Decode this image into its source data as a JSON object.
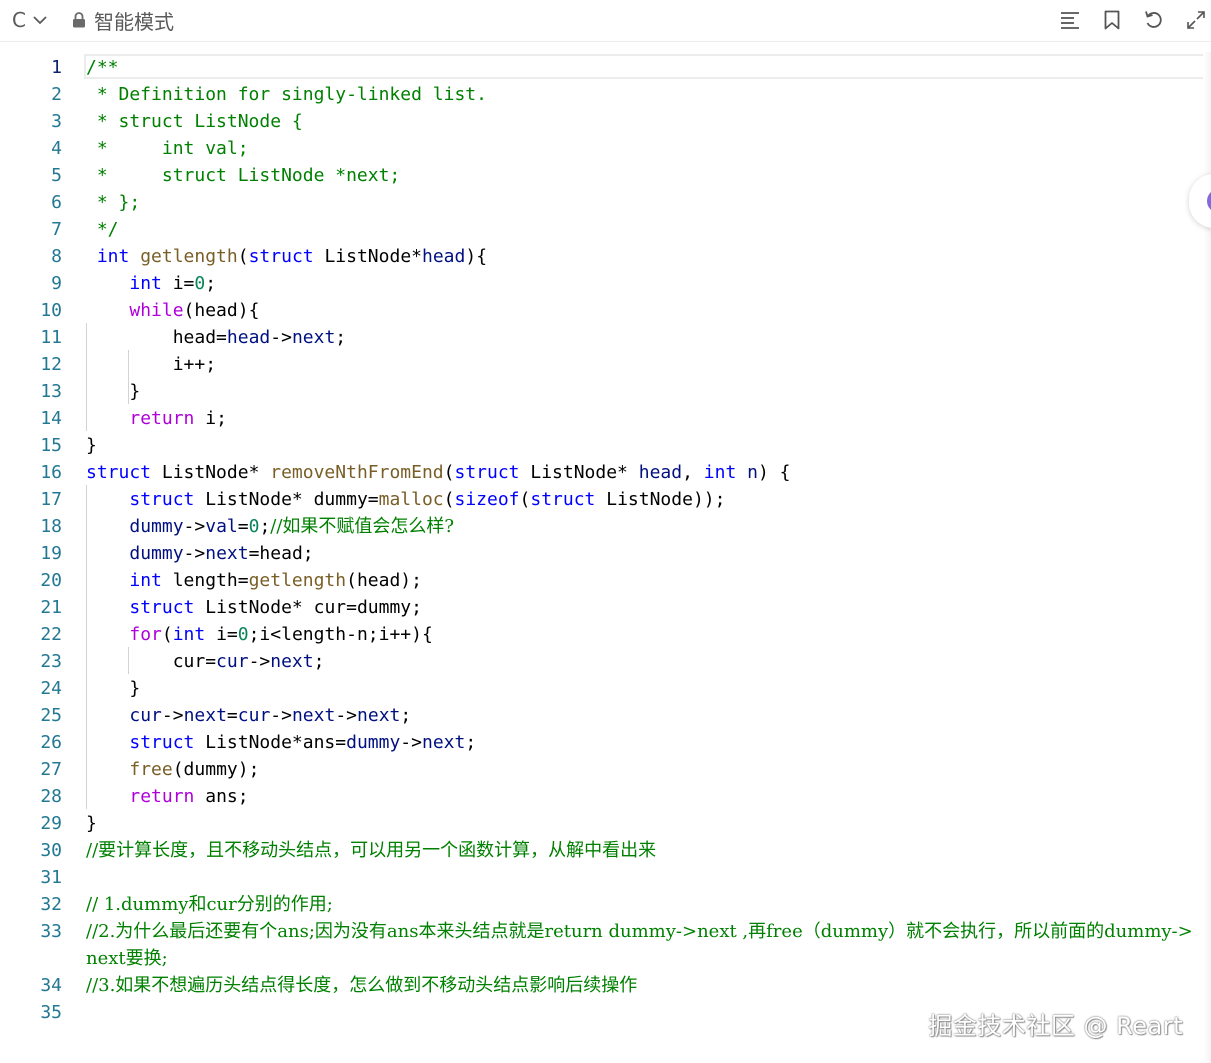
{
  "toolbar": {
    "language_label": "C",
    "mode_label": "智能模式",
    "icons": [
      "chevron-down-icon",
      "lock-icon",
      "format-icon",
      "bookmark-icon",
      "reset-icon",
      "expand-icon"
    ]
  },
  "colors": {
    "keyword": "#0000ff",
    "control": "#af00db",
    "function": "#795e26",
    "variable": "#001080",
    "number": "#098658",
    "comment": "#008000",
    "line_number": "#237893"
  },
  "editor": {
    "line_numbers": [
      "1",
      "2",
      "3",
      "4",
      "5",
      "6",
      "7",
      "8",
      "9",
      "10",
      "11",
      "12",
      "13",
      "14",
      "15",
      "16",
      "17",
      "18",
      "19",
      "20",
      "21",
      "22",
      "23",
      "24",
      "25",
      "26",
      "27",
      "28",
      "29",
      "30",
      "31",
      "32",
      "33",
      "34",
      "35"
    ],
    "lines": [
      [
        "/**"
      ],
      [
        " * Definition for singly-linked list."
      ],
      [
        " * struct ListNode {"
      ],
      [
        " *     int val;"
      ],
      [
        " *     struct ListNode *next;"
      ],
      [
        " * };"
      ],
      [
        " */"
      ],
      [
        " ",
        "int",
        " ",
        "getlength",
        "(",
        "struct",
        " ListNode*",
        "head",
        "){"
      ],
      [
        "    ",
        "int",
        " i=",
        "0",
        ";"
      ],
      [
        "    ",
        "while",
        "(head){"
      ],
      [
        "        head=",
        "head",
        "->",
        "next",
        ";"
      ],
      [
        "        i++;"
      ],
      [
        "    }"
      ],
      [
        "    ",
        "return",
        " i;"
      ],
      [
        "}"
      ],
      [
        "struct",
        " ListNode* ",
        "removeNthFromEnd",
        "(",
        "struct",
        " ListNode* ",
        "head",
        ", ",
        "int",
        " ",
        "n",
        ") {"
      ],
      [
        "    ",
        "struct",
        " ListNode* dummy=",
        "malloc",
        "(",
        "sizeof",
        "(",
        "struct",
        " ListNode));"
      ],
      [
        "    ",
        "dummy",
        "->",
        "val",
        "=",
        "0",
        ";",
        "//如果不赋值会怎么样?"
      ],
      [
        "    ",
        "dummy",
        "->",
        "next",
        "=head;"
      ],
      [
        "    ",
        "int",
        " length=",
        "getlength",
        "(head);"
      ],
      [
        "    ",
        "struct",
        " ListNode* ",
        "cur",
        "=dummy;"
      ],
      [
        "    ",
        "for",
        "(",
        "int",
        " i=",
        "0",
        ";i<length-n;i++){"
      ],
      [
        "        cur=",
        "cur",
        "->",
        "next",
        ";"
      ],
      [
        "    }"
      ],
      [
        "    ",
        "cur",
        "->",
        "next",
        "=",
        "cur",
        "->",
        "next",
        "->",
        "next",
        ";"
      ],
      [
        "    ",
        "struct",
        " ListNode*ans=",
        "dummy",
        "->",
        "next",
        ";"
      ],
      [
        "    ",
        "free",
        "(dummy);"
      ],
      [
        "    ",
        "return",
        " ans;"
      ],
      [
        "}"
      ],
      [
        "//要计算长度，且不移动头结点，可以用另一个函数计算，从解中看出来"
      ],
      [
        ""
      ],
      [
        "// 1.dummy和cur分别的作用;"
      ],
      [
        "//2.为什么最后还要有个ans;因为没有ans本来头结点就是return dummy->next ,再free（dummy）就不会执行，所以前面的dummy->next要换;"
      ],
      [
        "//3.如果不想遍历头结点得长度，怎么做到不移动头结点影响后续操作"
      ],
      [
        ""
      ]
    ]
  },
  "watermark": "掘金技术社区 @ Reart"
}
